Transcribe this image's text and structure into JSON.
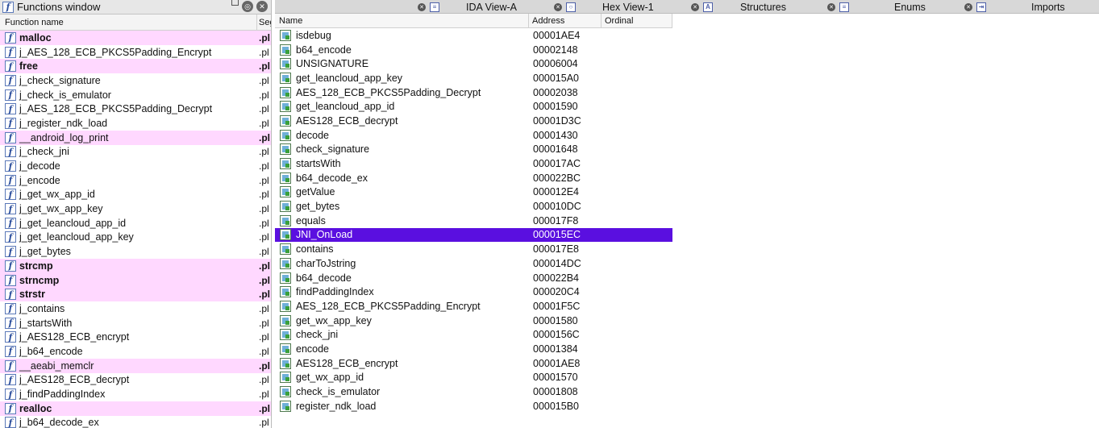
{
  "functions_window": {
    "title": "Functions window",
    "col_function_name": "Function name",
    "col_segment": "Seg",
    "rows": [
      {
        "name": "malloc",
        "seg": ".pl",
        "highlight": true
      },
      {
        "name": "j_AES_128_ECB_PKCS5Padding_Encrypt",
        "seg": ".pl",
        "highlight": false
      },
      {
        "name": "free",
        "seg": ".pl",
        "highlight": true
      },
      {
        "name": "j_check_signature",
        "seg": ".pl",
        "highlight": false
      },
      {
        "name": "j_check_is_emulator",
        "seg": ".pl",
        "highlight": false
      },
      {
        "name": "j_AES_128_ECB_PKCS5Padding_Decrypt",
        "seg": ".pl",
        "highlight": false
      },
      {
        "name": "j_register_ndk_load",
        "seg": ".pl",
        "highlight": false
      },
      {
        "name": "__android_log_print",
        "seg": ".pl",
        "highlight": true,
        "bold": false
      },
      {
        "name": "j_check_jni",
        "seg": ".pl",
        "highlight": false
      },
      {
        "name": "j_decode",
        "seg": ".pl",
        "highlight": false
      },
      {
        "name": "j_encode",
        "seg": ".pl",
        "highlight": false
      },
      {
        "name": "j_get_wx_app_id",
        "seg": ".pl",
        "highlight": false
      },
      {
        "name": "j_get_wx_app_key",
        "seg": ".pl",
        "highlight": false
      },
      {
        "name": "j_get_leancloud_app_id",
        "seg": ".pl",
        "highlight": false
      },
      {
        "name": "j_get_leancloud_app_key",
        "seg": ".pl",
        "highlight": false
      },
      {
        "name": "j_get_bytes",
        "seg": ".pl",
        "highlight": false
      },
      {
        "name": "strcmp",
        "seg": ".pl",
        "highlight": true
      },
      {
        "name": "strncmp",
        "seg": ".pl",
        "highlight": true
      },
      {
        "name": "strstr",
        "seg": ".pl",
        "highlight": true
      },
      {
        "name": "j_contains",
        "seg": ".pl",
        "highlight": false
      },
      {
        "name": "j_startsWith",
        "seg": ".pl",
        "highlight": false
      },
      {
        "name": "j_AES128_ECB_encrypt",
        "seg": ".pl",
        "highlight": false
      },
      {
        "name": "j_b64_encode",
        "seg": ".pl",
        "highlight": false
      },
      {
        "name": "__aeabi_memclr",
        "seg": ".pl",
        "highlight": true,
        "bold": false
      },
      {
        "name": "j_AES128_ECB_decrypt",
        "seg": ".pl",
        "highlight": false
      },
      {
        "name": "j_findPaddingIndex",
        "seg": ".pl",
        "highlight": false
      },
      {
        "name": "realloc",
        "seg": ".pl",
        "highlight": true
      },
      {
        "name": "j_b64_decode_ex",
        "seg": ".pl",
        "highlight": false
      }
    ]
  },
  "tabs": [
    {
      "label": "IDA View-A",
      "icon": "ida-view-icon"
    },
    {
      "label": "Hex View-1",
      "icon": "hex-view-icon"
    },
    {
      "label": "Structures",
      "icon": "structures-icon"
    },
    {
      "label": "Enums",
      "icon": "enums-icon"
    },
    {
      "label": "Imports",
      "icon": "imports-icon"
    }
  ],
  "names_window": {
    "col_name": "Name",
    "col_address": "Address",
    "col_ordinal": "Ordinal",
    "selected_index": 14,
    "rows": [
      {
        "name": "isdebug",
        "address": "00001AE4"
      },
      {
        "name": "b64_encode",
        "address": "00002148"
      },
      {
        "name": "UNSIGNATURE",
        "address": "00006004"
      },
      {
        "name": "get_leancloud_app_key",
        "address": "000015A0"
      },
      {
        "name": "AES_128_ECB_PKCS5Padding_Decrypt",
        "address": "00002038"
      },
      {
        "name": "get_leancloud_app_id",
        "address": "00001590"
      },
      {
        "name": "AES128_ECB_decrypt",
        "address": "00001D3C"
      },
      {
        "name": "decode",
        "address": "00001430"
      },
      {
        "name": "check_signature",
        "address": "00001648"
      },
      {
        "name": "startsWith",
        "address": "000017AC"
      },
      {
        "name": "b64_decode_ex",
        "address": "000022BC"
      },
      {
        "name": "getValue",
        "address": "000012E4"
      },
      {
        "name": "get_bytes",
        "address": "000010DC"
      },
      {
        "name": "equals",
        "address": "000017F8"
      },
      {
        "name": "JNI_OnLoad",
        "address": "000015EC"
      },
      {
        "name": "contains",
        "address": "000017E8"
      },
      {
        "name": "charToJstring",
        "address": "000014DC"
      },
      {
        "name": "b64_decode",
        "address": "000022B4"
      },
      {
        "name": "findPaddingIndex",
        "address": "000020C4"
      },
      {
        "name": "AES_128_ECB_PKCS5Padding_Encrypt",
        "address": "00001F5C"
      },
      {
        "name": "get_wx_app_key",
        "address": "00001580"
      },
      {
        "name": "check_jni",
        "address": "0000156C"
      },
      {
        "name": "encode",
        "address": "00001384"
      },
      {
        "name": "AES128_ECB_encrypt",
        "address": "00001AE8"
      },
      {
        "name": "get_wx_app_id",
        "address": "00001570"
      },
      {
        "name": "check_is_emulator",
        "address": "00001808"
      },
      {
        "name": "register_ndk_load",
        "address": "000015B0"
      }
    ]
  }
}
